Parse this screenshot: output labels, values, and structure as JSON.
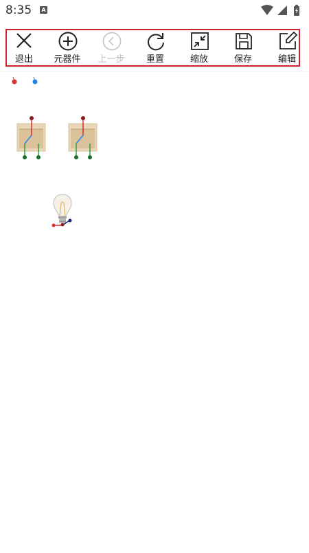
{
  "status_bar": {
    "time": "8:35",
    "notification_letter": "A"
  },
  "toolbar": {
    "exit_label": "退出",
    "components_label": "元器件",
    "undo_label": "上一步",
    "reset_label": "重置",
    "zoom_label": "缩放",
    "save_label": "保存",
    "edit_label": "编辑"
  },
  "colors": {
    "toolbar_border": "#d21f2e",
    "wire_red": "#d32f2f",
    "wire_green": "#2e9e3e",
    "wire_blue": "#1e88e5",
    "node_navy": "#1a237e",
    "switch_body": "#e9d6b6",
    "disabled_text": "#bdbdbd"
  },
  "icons": {
    "exit": "close-icon",
    "components": "plus-circle-icon",
    "undo": "chevron-left-circle-icon",
    "reset": "refresh-icon",
    "zoom": "compress-icon",
    "save": "floppy-disk-icon",
    "edit": "pencil-square-icon"
  },
  "canvas": {
    "components": [
      "battery-terminals",
      "switch",
      "switch",
      "light-bulb"
    ]
  }
}
